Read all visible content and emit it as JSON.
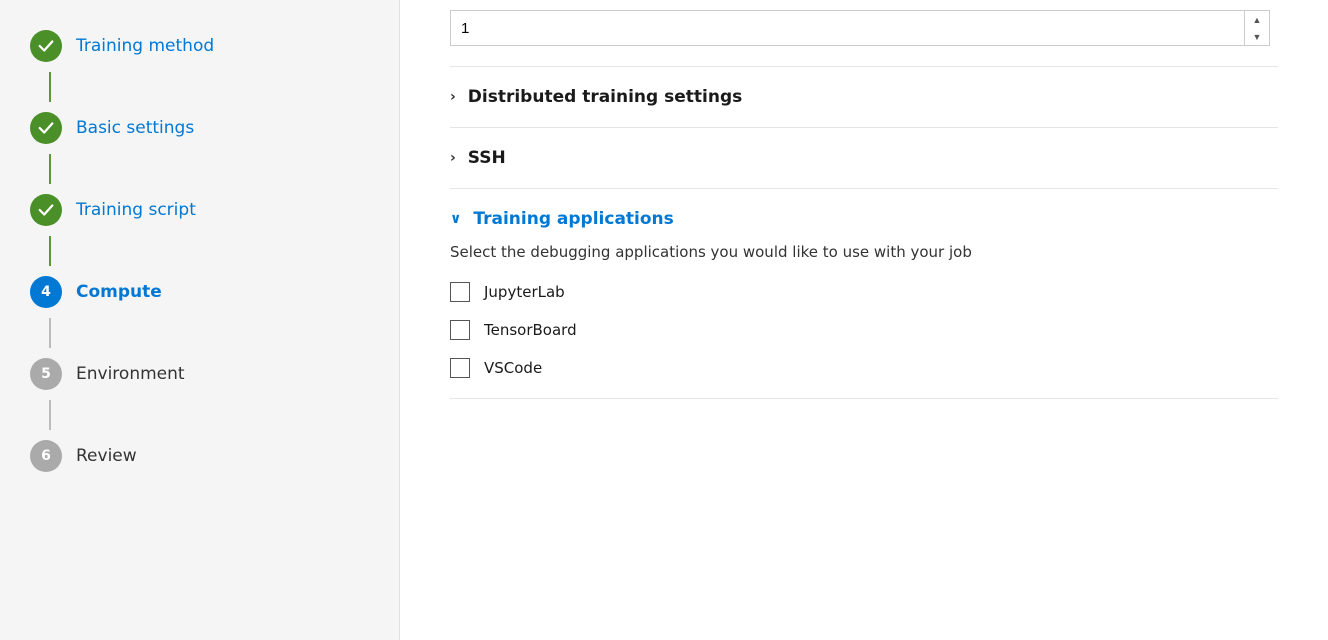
{
  "sidebar": {
    "steps": [
      {
        "id": "training-method",
        "label": "Training method",
        "status": "completed",
        "number": null
      },
      {
        "id": "basic-settings",
        "label": "Basic settings",
        "status": "completed",
        "number": null
      },
      {
        "id": "training-script",
        "label": "Training script",
        "status": "completed",
        "number": null
      },
      {
        "id": "compute",
        "label": "Compute",
        "status": "active",
        "number": "4"
      },
      {
        "id": "environment",
        "label": "Environment",
        "status": "inactive",
        "number": "5"
      },
      {
        "id": "review",
        "label": "Review",
        "status": "inactive",
        "number": "6"
      }
    ]
  },
  "main": {
    "number_input_value": "1",
    "sections": [
      {
        "id": "distributed-training-settings",
        "title": "Distributed training settings",
        "expanded": false,
        "chevron": "›"
      },
      {
        "id": "ssh",
        "title": "SSH",
        "expanded": false,
        "chevron": "›"
      },
      {
        "id": "training-applications",
        "title": "Training applications",
        "expanded": true,
        "chevron": "∨",
        "description": "Select the debugging applications you would like to use with your job",
        "checkboxes": [
          {
            "id": "jupyterlab",
            "label": "JupyterLab",
            "checked": false
          },
          {
            "id": "tensorboard",
            "label": "TensorBoard",
            "checked": false
          },
          {
            "id": "vscode",
            "label": "VSCode",
            "checked": false
          }
        ]
      }
    ]
  }
}
